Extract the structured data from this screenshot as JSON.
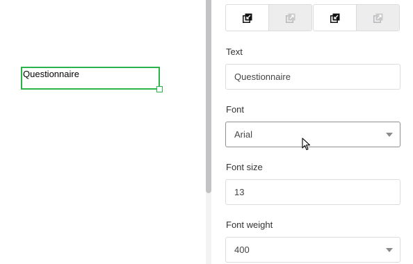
{
  "canvas": {
    "element_text": "Questionnaire"
  },
  "panel": {
    "fields": {
      "text": {
        "label": "Text",
        "value": "Questionnaire"
      },
      "font": {
        "label": "Font",
        "value": "Arial"
      },
      "font_size": {
        "label": "Font size",
        "value": "13"
      },
      "font_weight": {
        "label": "Font weight",
        "value": "400"
      }
    },
    "layer_buttons": [
      {
        "icon": "bring-forward-icon",
        "enabled": true
      },
      {
        "icon": "send-backward-icon",
        "enabled": false
      },
      {
        "icon": "bring-to-front-icon",
        "enabled": true
      },
      {
        "icon": "send-to-back-icon",
        "enabled": false
      }
    ]
  },
  "colors": {
    "selection": "#2ab34a",
    "divider_thumb": "#c3c3c6"
  }
}
